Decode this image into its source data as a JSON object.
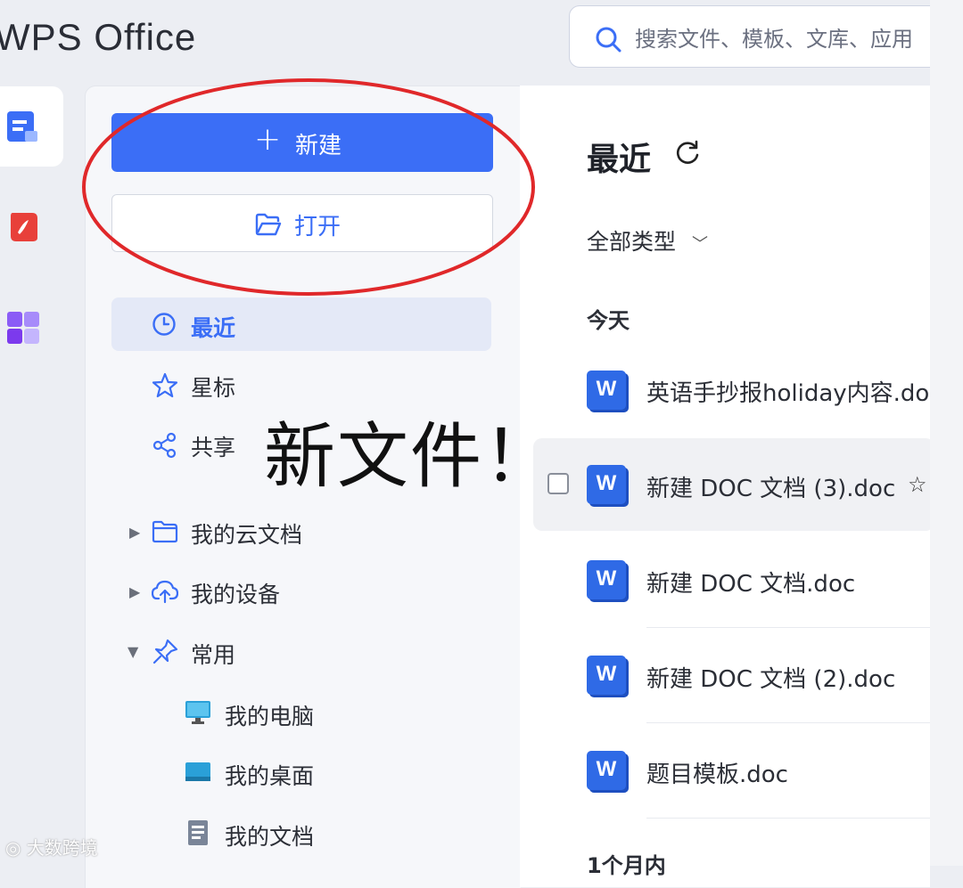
{
  "app": {
    "brand": "WPS Office"
  },
  "search": {
    "placeholder": "搜索文件、模板、文库、应用"
  },
  "sidebar": {
    "new_label": "新建",
    "open_label": "打开",
    "nav": {
      "recent": "最近",
      "starred": "星标",
      "shared": "共享",
      "cloud_docs": "我的云文档",
      "devices": "我的设备",
      "common": "常用",
      "my_computer": "我的电脑",
      "my_desktop": "我的桌面",
      "my_documents": "我的文档"
    }
  },
  "annotation": {
    "text": "新文件！"
  },
  "main": {
    "title": "最近",
    "filter": "全部类型",
    "section_today": "今天",
    "section_month": "1个月内",
    "files": [
      {
        "icon": "W",
        "name": "英语手抄报holiday内容.doc"
      },
      {
        "icon": "W",
        "name": "新建 DOC 文档 (3).doc"
      },
      {
        "icon": "W",
        "name": "新建 DOC 文档.doc"
      },
      {
        "icon": "W",
        "name": "新建 DOC 文档 (2).doc"
      },
      {
        "icon": "W",
        "name": "题目模板.doc"
      }
    ]
  },
  "watermark": "大数跨境",
  "colors": {
    "accent": "#3b6ef6",
    "annotation_red": "#e0282a",
    "word_blue": "#2f6ae6"
  }
}
